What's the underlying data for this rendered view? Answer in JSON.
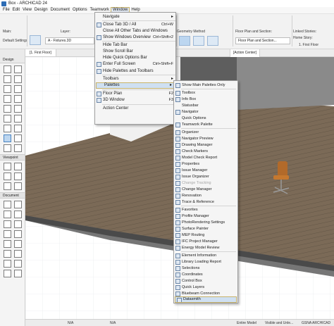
{
  "window": {
    "title": "Box - ARCHICAD 24"
  },
  "menubar": [
    "File",
    "Edit",
    "View",
    "Design",
    "Document",
    "Options",
    "Teamwork",
    "Window",
    "Help"
  ],
  "ribbon": {
    "main_label": "Main:",
    "layer_label": "Layer:",
    "default_settings": "Default Settings",
    "layer_value": "A - Fixtures.3D",
    "geometry_label": "Geometry Method",
    "floorplan_label": "Floor Plan and Section:",
    "floorplan_value": "Floor Plan and Section...",
    "home_story_label": "Linked Stories:",
    "home_story_value": "Home Story:",
    "first_floor": "1. First Floor"
  },
  "toolbox": {
    "sections": [
      "Design",
      "Viewpoint",
      "Document"
    ]
  },
  "viewport": {
    "tab_active": "[1. First Floor]",
    "tab_action": "[Action Center]"
  },
  "statusbar": {
    "na1": "N/A",
    "na2": "N/A",
    "model": "Entire Model",
    "visible": "Visible and Unle...",
    "gsna": "GSNA ARCHICAD V..."
  },
  "window_menu": [
    {
      "label": "Navigate",
      "shortcut": "",
      "arrow": true,
      "icon": false
    },
    {
      "label": "Close Tab 3D / All",
      "shortcut": "Ctrl+W",
      "arrow": false,
      "icon": true
    },
    {
      "label": "Close All Other Tabs and Windows",
      "shortcut": "",
      "arrow": false,
      "icon": false
    },
    {
      "label": "Show Windows Overview",
      "shortcut": "Ctrl+Shift+2",
      "arrow": false,
      "icon": true
    },
    {
      "label": "Hide Tab Bar",
      "shortcut": "",
      "arrow": false,
      "icon": false
    },
    {
      "label": "Show Scroll Bar",
      "shortcut": "",
      "arrow": false,
      "icon": false
    },
    {
      "label": "Hide Quick Options Bar",
      "shortcut": "",
      "arrow": false,
      "icon": false
    },
    {
      "label": "Enter Full Screen",
      "shortcut": "Ctrl+Shift+F",
      "arrow": false,
      "icon": true
    },
    {
      "label": "Hide Palettes and Toolbars",
      "shortcut": "",
      "arrow": false,
      "icon": true
    },
    {
      "label": "Toolbars",
      "shortcut": "",
      "arrow": true,
      "icon": false
    },
    {
      "label": "Palettes",
      "shortcut": "",
      "arrow": true,
      "icon": false
    },
    {
      "label": "Floor Plan",
      "shortcut": "F2",
      "arrow": false,
      "icon": true
    },
    {
      "label": "3D Window",
      "shortcut": "F3",
      "arrow": false,
      "icon": true
    },
    {
      "label": "Action Center",
      "shortcut": "",
      "arrow": false,
      "icon": false
    }
  ],
  "palettes_menu": [
    {
      "label": "Show Main Palettes Only",
      "icon": true
    },
    {
      "label": "Toolbox",
      "icon": true
    },
    {
      "label": "Info Box",
      "icon": true
    },
    {
      "label": "Statusbar",
      "icon": false
    },
    {
      "label": "Navigator",
      "icon": true
    },
    {
      "label": "Quick Options",
      "icon": false
    },
    {
      "label": "Teamwork Palette",
      "icon": true
    },
    {
      "label": "Organizer",
      "icon": true
    },
    {
      "label": "Navigator Preview",
      "icon": true
    },
    {
      "label": "Drawing Manager",
      "icon": true
    },
    {
      "label": "Check Markers",
      "icon": true
    },
    {
      "label": "Model Check Report",
      "icon": true
    },
    {
      "label": "Properties",
      "icon": true
    },
    {
      "label": "Issue Manager",
      "icon": true
    },
    {
      "label": "Issue Organizer",
      "icon": true
    },
    {
      "label": "Change Tracking",
      "icon": true
    },
    {
      "label": "Change Manager",
      "icon": true
    },
    {
      "label": "Renovation",
      "icon": true
    },
    {
      "label": "Trace & Reference",
      "icon": true
    },
    {
      "label": "Favorites",
      "icon": true
    },
    {
      "label": "Profile Manager",
      "icon": true
    },
    {
      "label": "PhotoRendering Settings",
      "icon": true
    },
    {
      "label": "Surface Painter",
      "icon": true
    },
    {
      "label": "MEP Routing",
      "icon": true
    },
    {
      "label": "IFC Project Manager",
      "icon": true
    },
    {
      "label": "Energy Model Review",
      "icon": true
    },
    {
      "label": "Element Information",
      "icon": true
    },
    {
      "label": "Library Loading Report",
      "icon": true
    },
    {
      "label": "Selections",
      "icon": true
    },
    {
      "label": "Coordinates",
      "icon": true
    },
    {
      "label": "Control Box",
      "icon": true
    },
    {
      "label": "Quick Layers",
      "icon": true
    },
    {
      "label": "Bluebeam Connection",
      "icon": true
    },
    {
      "label": "Datasmith",
      "icon": true
    }
  ],
  "colors": {
    "accent_outline": "#c8b36a",
    "highlight_fill": "#cfe0f2",
    "deck": "#7b6a57",
    "wall": "#5e5e5e"
  }
}
